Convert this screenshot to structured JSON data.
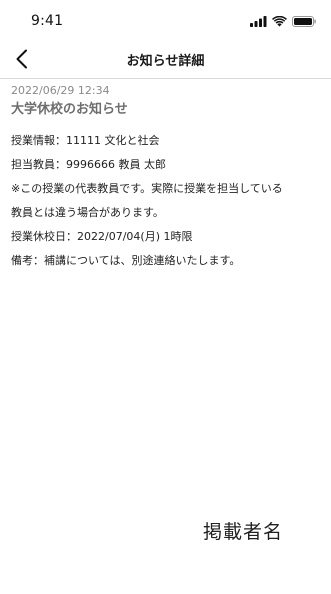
{
  "status_bar": {
    "time": "9:41",
    "icons": [
      "signal-icon",
      "wifi-icon",
      "battery-icon"
    ]
  },
  "nav": {
    "back_icon": "chevron-left-icon",
    "title": "お知らせ詳細"
  },
  "notice": {
    "date": "2022/06/29 12:34",
    "title": "大学休校のお知らせ",
    "lines": [
      "授業情報：11111 文化と社会",
      "担当教員：9996666 教員 太郎",
      "※この授業の代表教員です。実際に授業を担当している",
      "教員とは違う場合があります。",
      "授業休校日：2022/07/04(月) 1時限",
      "備考：補講については、別途連絡いたします。"
    ],
    "publisher": "掲載者名"
  }
}
